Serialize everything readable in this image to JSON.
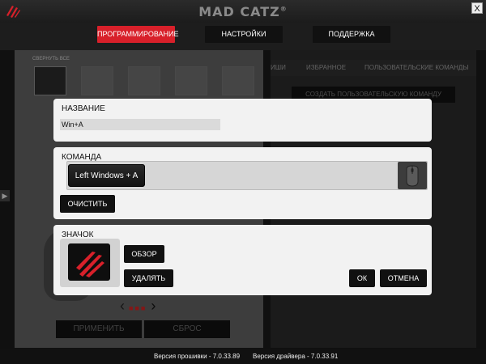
{
  "window": {
    "brand": "MAD CATZ",
    "brand_mark": "®",
    "close_label": "X"
  },
  "nav": {
    "programming": "ПРОГРАММИРОВАНИЕ",
    "settings": "НАСТРОЙКИ",
    "support": "ПОДДЕРЖКА",
    "active_color": "#d8202a"
  },
  "background": {
    "collapse_all": "СВЕРНУТЬ ВСЕ",
    "apply": "ПРИМЕНИТЬ",
    "reset": "СБРОС",
    "right_tabs": [
      "ИШИ",
      "ИЗБРАННОЕ",
      "ПОЛЬЗОВАТЕЛЬСКИЕ КОМАНДЫ"
    ],
    "create_custom": "СОЗДАТЬ ПОЛЬЗОВАТЕЛЬСКУЮ КОМАНДУ"
  },
  "dialog": {
    "name_section": {
      "title": "НАЗВАНИЕ",
      "value": "Win+A"
    },
    "command_section": {
      "title": "КОМАНДА",
      "key_chip": "Left Windows + A",
      "clear": "ОЧИСТИТЬ"
    },
    "icon_section": {
      "title": "ЗНАЧОК",
      "browse": "ОБЗОР",
      "delete": "УДАЛЯТЬ",
      "ok": "ОК",
      "cancel": "ОТМЕНА"
    }
  },
  "status": {
    "firmware": "Версия прошивки - 7.0.33.89",
    "driver": "Версия драйвера - 7.0.33.91"
  }
}
